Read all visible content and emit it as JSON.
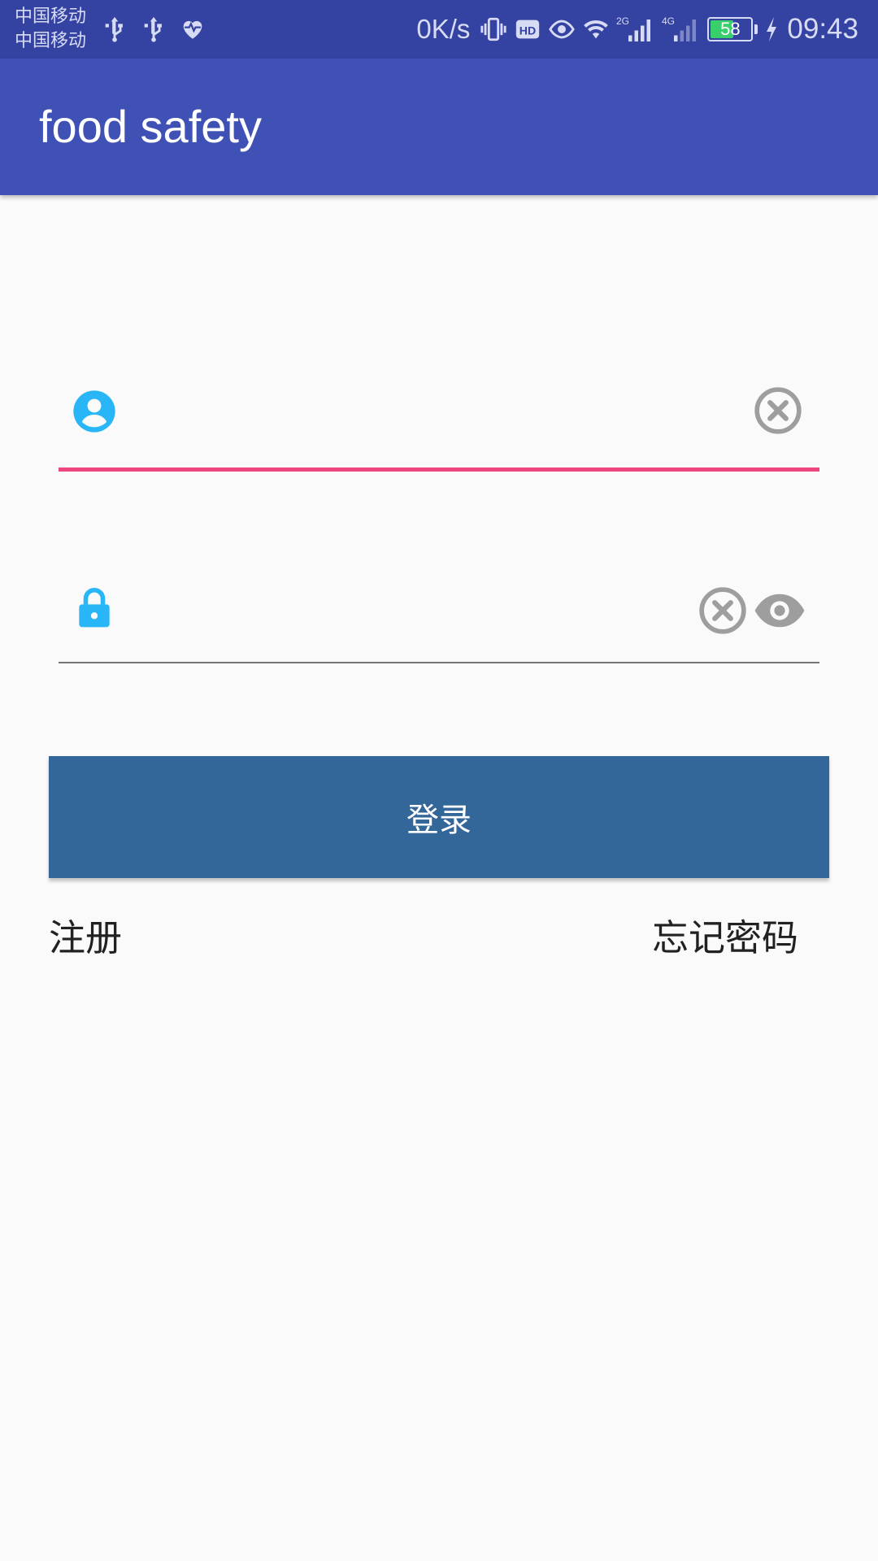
{
  "status_bar": {
    "carrier_1": "中国移动",
    "carrier_2": "中国移动",
    "net_speed": "0K/s",
    "network_2g": "2G",
    "network_4g": "4G",
    "hd_label": "HD",
    "battery_level": "58",
    "battery_fraction": 0.58,
    "time": "09:43",
    "icons": [
      "usb-icon",
      "usb-icon",
      "health-heart-icon",
      "vibrate-icon",
      "hd-icon",
      "eye-comfort-icon",
      "wifi-icon",
      "signal-2g-icon",
      "signal-4g-icon",
      "battery-icon",
      "charging-bolt-icon"
    ]
  },
  "app_bar": {
    "title": "food safety"
  },
  "login_form": {
    "username": {
      "value": "",
      "placeholder": "",
      "icon": "user-circle-icon",
      "clear_icon": "clear-circle-icon"
    },
    "password": {
      "value": "",
      "placeholder": "",
      "icon": "lock-icon",
      "clear_icon": "clear-circle-icon",
      "visibility_icon": "eye-icon"
    },
    "login_label": "登录",
    "register_label": "注册",
    "forgot_label": "忘记密码"
  },
  "colors": {
    "status_bar": "#3443a1",
    "app_bar": "#3f51b5",
    "accent": "#ee4680",
    "icon_blue": "#29b6f6",
    "button": "#336699",
    "background": "#fafafa"
  }
}
